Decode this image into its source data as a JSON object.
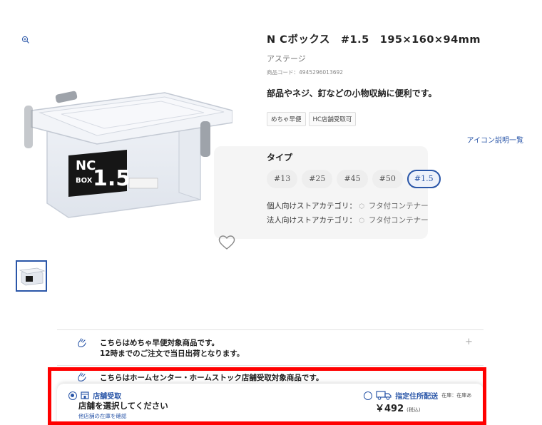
{
  "product": {
    "title": "N Cボックス　#1.5　195×160×94mm",
    "brand": "アステージ",
    "code": "商品コード：4945296013692",
    "catch": "部品やネジ、釘などの小物収納に便利です。",
    "box_label_top": "NC",
    "box_label_bottom": "BOX",
    "box_label_size": "1.5"
  },
  "badges": [
    "めちゃ早便",
    "HC店舗受取可"
  ],
  "icon_list_link": "アイコン説明一覧",
  "type_section": {
    "label": "タイプ",
    "options": [
      "#13",
      "#25",
      "#45",
      "#50",
      "#1.5"
    ],
    "selected": "#1.5"
  },
  "categories": {
    "personal_label": "個人向けストアカテゴリ：",
    "personal_value": "フタ付コンテナー",
    "corporate_label": "法人向けストアカテゴリ：",
    "corporate_value": "フタ付コンテナー"
  },
  "notices": {
    "express_line1": "こちらはめちゃ早便対象商品です。",
    "express_line2": "12時までのご注文で当日出荷となります。",
    "expand_symbol": "+",
    "store_pickup": "こちらはホームセンター・ホームストック店舗受取対象商品です。"
  },
  "delivery": {
    "store_option_label": "店舗受取",
    "store_select_text": "店舗を選択してください",
    "store_stock_link": "他店舗の在庫を確認",
    "ship_option_label": "指定住所配送",
    "ship_stock_note": "在庫：在庫あ",
    "price": "￥492",
    "tax_note": "(税込)",
    "selected": "store"
  },
  "colors": {
    "accent": "#2a56a8",
    "highlight_border": "#ff0000"
  },
  "icons": [
    "zoom-icon",
    "heart-icon",
    "hand-icon",
    "store-icon",
    "truck-icon",
    "tag-icon"
  ]
}
